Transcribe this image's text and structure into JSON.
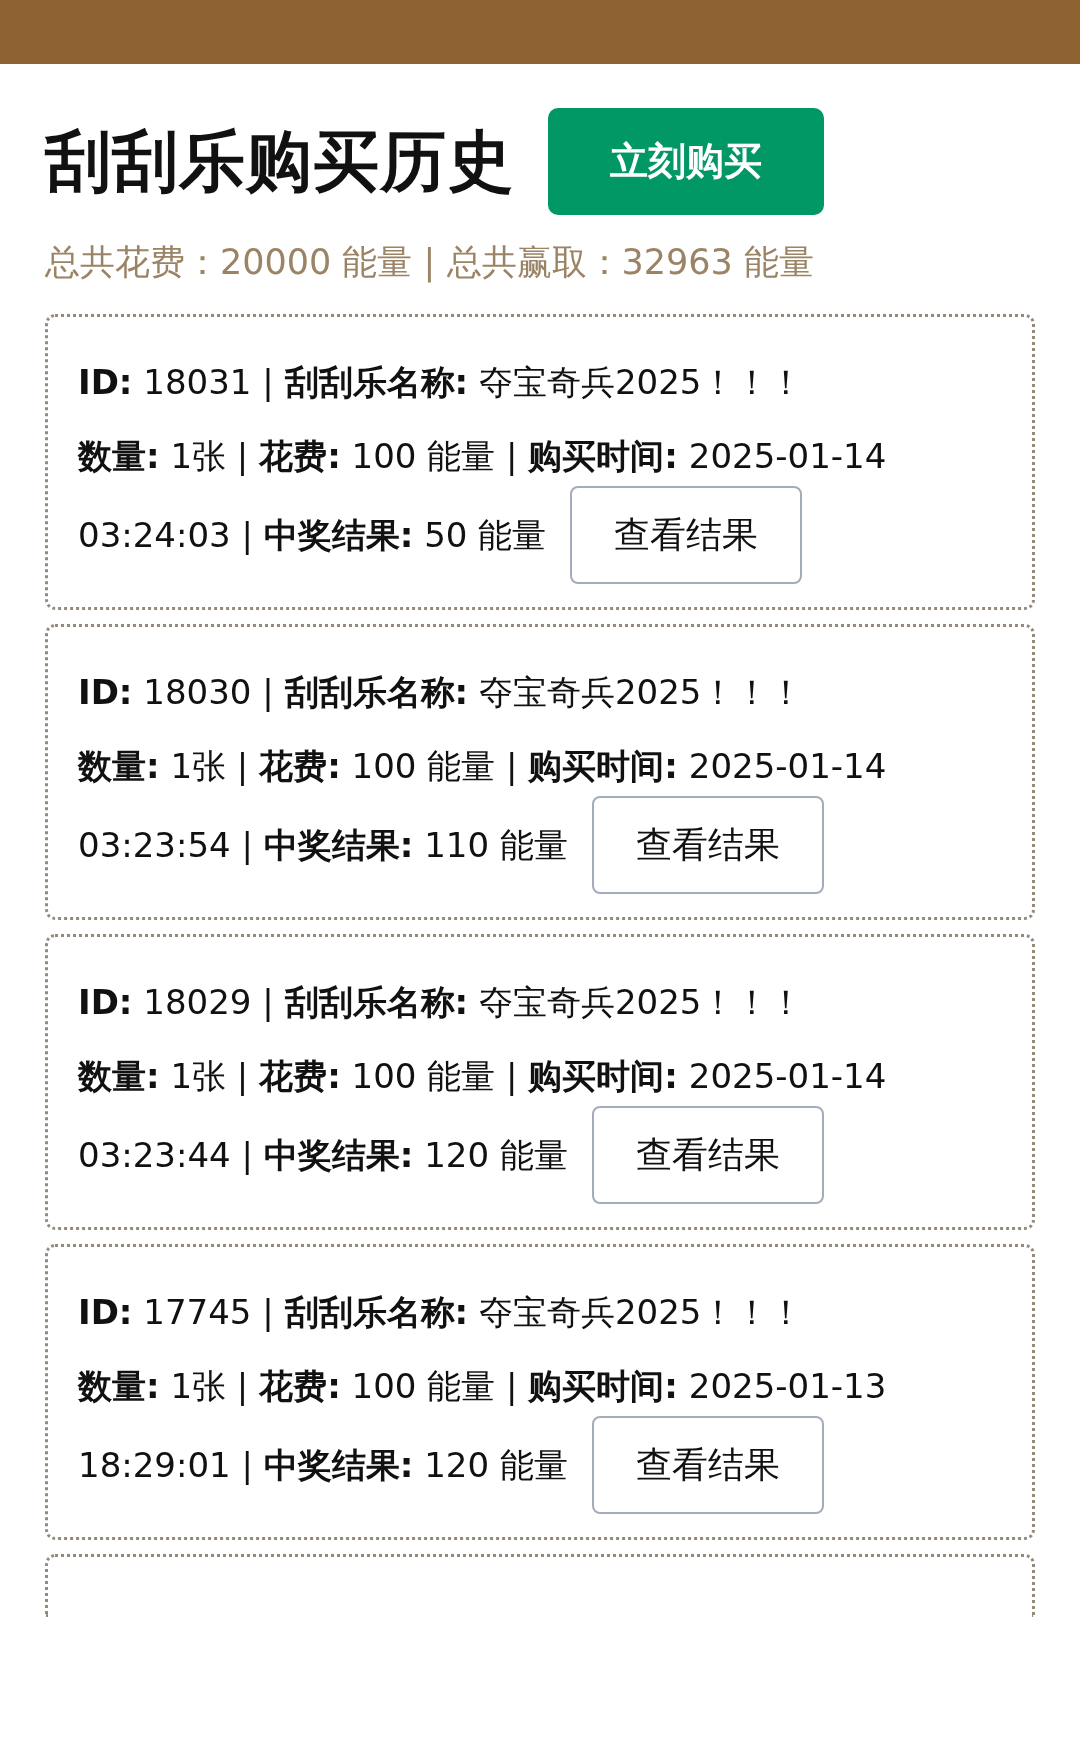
{
  "title": "刮刮乐购买历史",
  "buy_button": "立刻购买",
  "summary": "总共花费：20000 能量 | 总共赢取：32963 能量",
  "records": [
    {
      "lines": [
        "**ID:** 18031 | **刮刮乐名称:** 夺宝奇兵2025！！！",
        "**数量:** 1张 | **花费:** 100 能量 | **购买时间:** 2025-01-14",
        "03:24:03 | **中奖结果:** 50 能量"
      ],
      "button": "查看结果"
    },
    {
      "lines": [
        "**ID:** 18030 | **刮刮乐名称:** 夺宝奇兵2025！！！",
        "**数量:** 1张 | **花费:** 100 能量 | **购买时间:** 2025-01-14",
        "03:23:54 | **中奖结果:** 110 能量"
      ],
      "button": "查看结果"
    },
    {
      "lines": [
        "**ID:** 18029 | **刮刮乐名称:** 夺宝奇兵2025！！！",
        "**数量:** 1张 | **花费:** 100 能量 | **购买时间:** 2025-01-14",
        "03:23:44 | **中奖结果:** 120 能量"
      ],
      "button": "查看结果"
    },
    {
      "lines": [
        "**ID:** 17745 | **刮刮乐名称:** 夺宝奇兵2025！！！",
        "**数量:** 1张 | **花费:** 100 能量 | **购买时间:** 2025-01-13",
        "18:29:01 | **中奖结果:** 120 能量"
      ],
      "button": "查看结果"
    }
  ]
}
